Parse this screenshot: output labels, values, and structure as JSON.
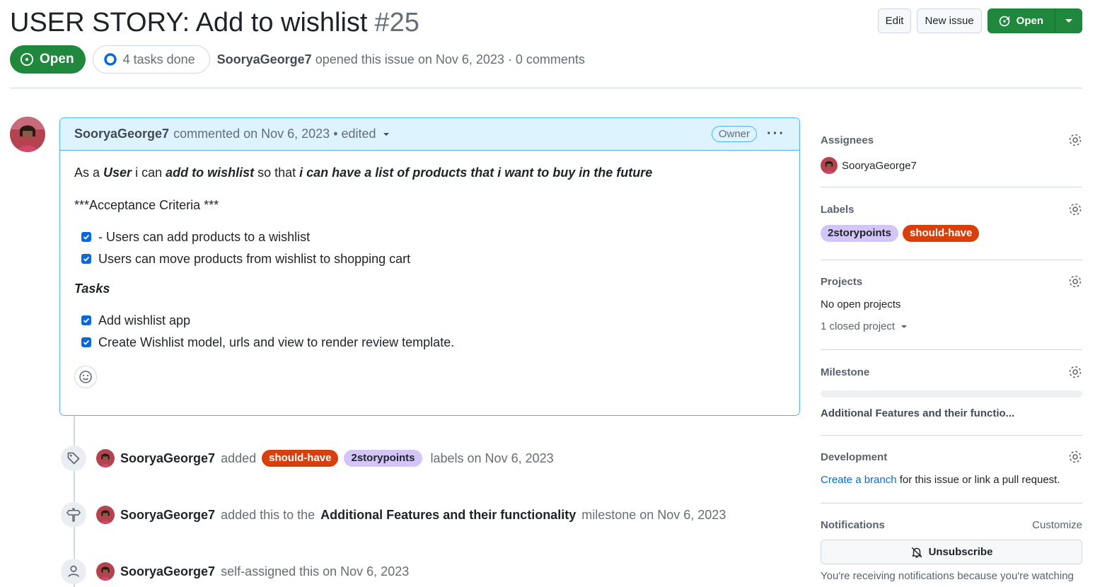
{
  "issue": {
    "title": "USER STORY: Add to wishlist",
    "number": "#25",
    "state": "Open",
    "tasks": "4 tasks done",
    "author": "SooryaGeorge7",
    "opened_text": "opened this issue on Nov 6, 2023 · 0 comments"
  },
  "header_buttons": {
    "edit": "Edit",
    "new_issue": "New issue",
    "open": "Open"
  },
  "comment": {
    "author": "SooryaGeorge7",
    "meta": "commented on Nov 6, 2023 • edited",
    "role": "Owner",
    "intro": {
      "p1": "As a ",
      "role_term": "User",
      "p2": " i can ",
      "action": "add to wishlist",
      "p3": " so that ",
      "goal": "i can have a list of products that i want to buy in the future"
    },
    "criteria_heading": "***Acceptance Criteria ***",
    "criteria": [
      "- Users can add products to a wishlist",
      "Users can move products from wishlist to shopping cart"
    ],
    "tasks_heading": "Tasks",
    "tasks": [
      "Add wishlist app",
      "Create Wishlist model, urls and view to render review template."
    ]
  },
  "events": {
    "labels": {
      "user": "SooryaGeorge7",
      "verb": "added",
      "label_a": "should-have",
      "label_b": "2storypoints",
      "tail": "labels on Nov 6, 2023"
    },
    "milestone": {
      "user": "SooryaGeorge7",
      "verb": "added this to the",
      "name": "Additional Features and their functionality",
      "tail": "milestone on Nov 6, 2023"
    },
    "assign": {
      "user": "SooryaGeorge7",
      "tail": "self-assigned this on Nov 6, 2023"
    }
  },
  "sidebar": {
    "assignees": {
      "title": "Assignees",
      "user": "SooryaGeorge7"
    },
    "labels": {
      "title": "Labels",
      "items": [
        "2storypoints",
        "should-have"
      ]
    },
    "projects": {
      "title": "Projects",
      "none": "No open projects",
      "closed": "1 closed project"
    },
    "milestone": {
      "title": "Milestone",
      "name": "Additional Features and their functio..."
    },
    "development": {
      "title": "Development",
      "link": "Create a branch",
      "rest": " for this issue or link a pull request."
    },
    "notifications": {
      "title": "Notifications",
      "customize": "Customize",
      "button": "Unsubscribe",
      "note": "You're receiving notifications because you're watching"
    }
  },
  "colors": {
    "open_green": "#1f883d",
    "label_red": "#d93f0b",
    "label_purple": "#d4c5f9",
    "link_blue": "#0969da"
  }
}
